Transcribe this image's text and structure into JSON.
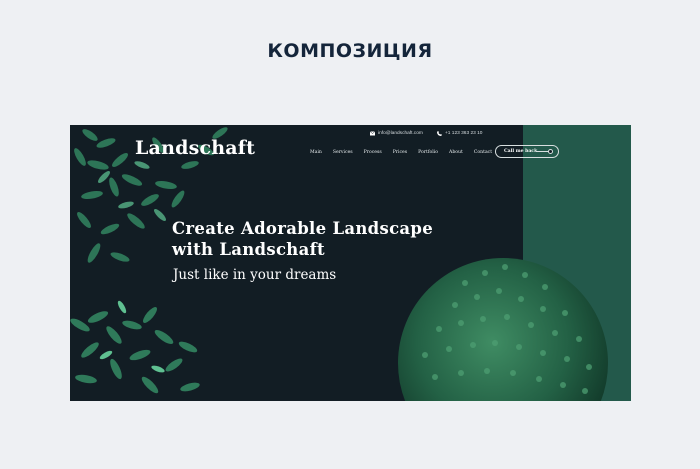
{
  "page": {
    "heading": "КОМПОЗИЦИЯ"
  },
  "site": {
    "logo": "Landschaft",
    "email": "info@landschaft.com",
    "phone": "+1 123 363 23 10",
    "nav": [
      "Main",
      "Services",
      "Process",
      "Prices",
      "Portfolio",
      "About",
      "Contact"
    ],
    "cta_label": "Call me back",
    "hero_title_line1": "Create Adorable Landscape",
    "hero_title_line2": "with Landschaft",
    "hero_subtitle": "Just like in your dreams"
  },
  "colors": {
    "background": "#eef0f3",
    "heading": "#14253a",
    "hero_bg": "#121d24",
    "accent_panel": "#23594b",
    "leaf": "#2f7a5a"
  },
  "icons": {
    "email": "envelope-icon",
    "phone": "phone-icon",
    "cta_arrow": "arrow-right-icon"
  }
}
